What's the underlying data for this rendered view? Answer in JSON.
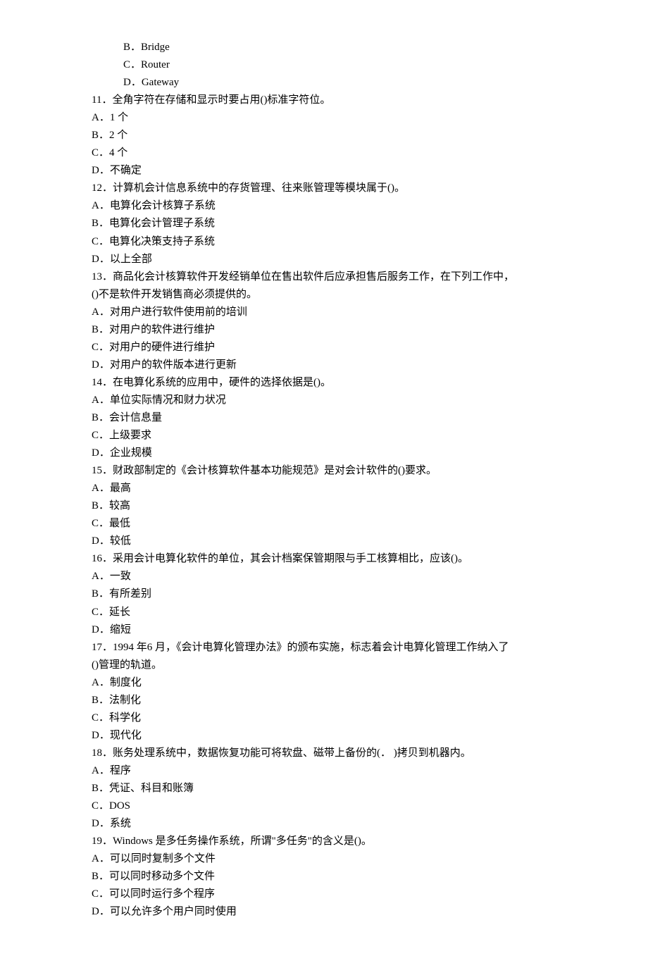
{
  "lines": [
    {
      "text": "B．Bridge",
      "indent": true
    },
    {
      "text": "C．Router",
      "indent": true
    },
    {
      "text": "D．Gateway",
      "indent": true
    },
    {
      "text": "11．全角字符在存储和显示时要占用()标准字符位。",
      "indent": false
    },
    {
      "text": "A．1 个",
      "indent": false
    },
    {
      "text": "B．2 个",
      "indent": false
    },
    {
      "text": "C．4 个",
      "indent": false
    },
    {
      "text": "D．不确定",
      "indent": false
    },
    {
      "text": "12．计算机会计信息系统中的存货管理、往来账管理等模块属于()。",
      "indent": false
    },
    {
      "text": "A．电算化会计核算子系统",
      "indent": false
    },
    {
      "text": "B．电算化会计管理子系统",
      "indent": false
    },
    {
      "text": "C．电算化决策支持子系统",
      "indent": false
    },
    {
      "text": "D．以上全部",
      "indent": false
    },
    {
      "text": "13．商品化会计核算软件开发经销单位在售出软件后应承担售后服务工作，在下列工作中，",
      "indent": false
    },
    {
      "text": "()不是软件开发销售商必须提供的。",
      "indent": false
    },
    {
      "text": "A．对用户进行软件使用前的培训",
      "indent": false
    },
    {
      "text": "B．对用户的软件进行维护",
      "indent": false
    },
    {
      "text": "C．对用户的硬件进行维护",
      "indent": false
    },
    {
      "text": "D．对用户的软件版本进行更新",
      "indent": false
    },
    {
      "text": "14．在电算化系统的应用中，硬件的选择依据是()。",
      "indent": false
    },
    {
      "text": "A．单位实际情况和财力状况",
      "indent": false
    },
    {
      "text": "B．会计信息量",
      "indent": false
    },
    {
      "text": "C．上级要求",
      "indent": false
    },
    {
      "text": "D．企业规模",
      "indent": false
    },
    {
      "text": "15．财政部制定的《会计核算软件基本功能规范》是对会计软件的()要求。",
      "indent": false
    },
    {
      "text": "A．最高",
      "indent": false
    },
    {
      "text": "B．较高",
      "indent": false
    },
    {
      "text": "C．最低",
      "indent": false
    },
    {
      "text": "D．较低",
      "indent": false
    },
    {
      "text": "16．采用会计电算化软件的单位，其会计档案保管期限与手工核算相比，应该()。",
      "indent": false
    },
    {
      "text": "A．一致",
      "indent": false
    },
    {
      "text": "B．有所差别",
      "indent": false
    },
    {
      "text": "C．延长",
      "indent": false
    },
    {
      "text": "D．缩短",
      "indent": false
    },
    {
      "text": "17．1994 年6 月，《会计电算化管理办法》的颁布实施，标志着会计电算化管理工作纳入了",
      "indent": false
    },
    {
      "text": "()管理的轨道。",
      "indent": false
    },
    {
      "text": "A．制度化",
      "indent": false
    },
    {
      "text": "B．法制化",
      "indent": false
    },
    {
      "text": "C．科学化",
      "indent": false
    },
    {
      "text": "D．现代化",
      "indent": false
    },
    {
      "text": "18．账务处理系统中，数据恢复功能可将软盘、磁带上备份的(． )拷贝到机器内。",
      "indent": false
    },
    {
      "text": "A．程序",
      "indent": false
    },
    {
      "text": "B．凭证、科目和账簿",
      "indent": false
    },
    {
      "text": "C．DOS",
      "indent": false
    },
    {
      "text": "D．系统",
      "indent": false
    },
    {
      "text": "19．Windows 是多任务操作系统，所谓\"多任务\"的含义是()。",
      "indent": false
    },
    {
      "text": "A．可以同时复制多个文件",
      "indent": false
    },
    {
      "text": "B．可以同时移动多个文件",
      "indent": false
    },
    {
      "text": "C．可以同时运行多个程序",
      "indent": false
    },
    {
      "text": "D．可以允许多个用户同时使用",
      "indent": false
    }
  ]
}
